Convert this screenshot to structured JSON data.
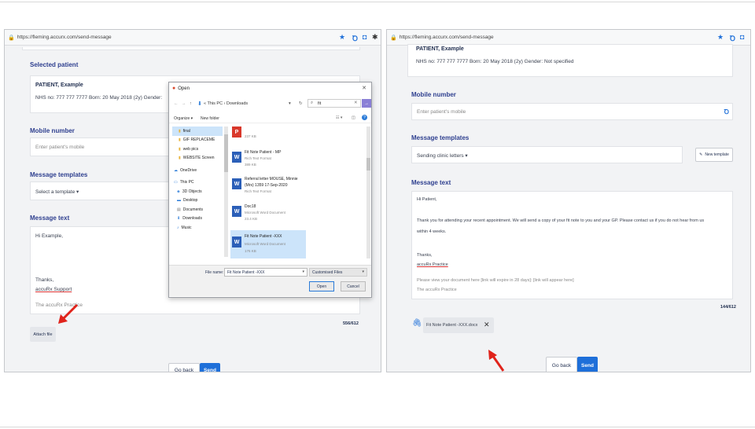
{
  "left": {
    "url": "https://fleming.accurx.com/send-message",
    "selected_patient_heading": "Selected patient",
    "patient_name": "PATIENT, Example",
    "patient_details": "NHS no: 777 777 7777    Born: 20 May 2018 (2y)    Gender:",
    "mobile_heading": "Mobile number",
    "mobile_placeholder": "Enter patient's mobile",
    "templates_heading": "Message templates",
    "template_select": "Select a template ▾",
    "message_heading": "Message text",
    "message_lines": [
      "Hi Example,",
      "Thanks,",
      "accuRx Support",
      "The accuRx Practice"
    ],
    "char_count": "556/612",
    "attach_button": "Attach file",
    "go_back": "Go back",
    "send": "Send"
  },
  "dialog": {
    "title": "Open",
    "path": "« This PC › Downloads",
    "search": "fit",
    "organize": "Organize ▾",
    "new_folder": "New folder",
    "tree": [
      "final",
      "GIF REPLACEME",
      "web pics",
      "WEBSITE Screen",
      "OneDrive",
      "This PC",
      "3D Objects",
      "Desktop",
      "Documents",
      "Downloads",
      "Music"
    ],
    "files": [
      {
        "name": "",
        "type": "",
        "size": "237 KB",
        "icon": "pdf-icon"
      },
      {
        "name": "Fit Note Patient - MP",
        "type": "Rich Text Format",
        "size": "389 KB",
        "icon": "word-icon"
      },
      {
        "name": "Referral letter MOUSE, Minnie",
        "name2": "(Mrs) 1359 17-Sep-2020",
        "type": "Rich Text Format",
        "size": "",
        "icon": "word-icon"
      },
      {
        "name": "Doc18",
        "type": "Microsoft Word Document",
        "size": "23.4 KB",
        "icon": "word-icon"
      },
      {
        "name": "Fit Note Patient -XXX",
        "type": "Microsoft Word Document",
        "size": "176 KB",
        "icon": "word-icon"
      }
    ],
    "file_name_label": "File name:",
    "file_name_value": "Fit Note Patient -XXX",
    "filter": "Customised Files",
    "open": "Open",
    "cancel": "Cancel"
  },
  "right": {
    "url": "https://fleming.accurx.com/send-message",
    "patient_name": "PATIENT, Example",
    "patient_details": "NHS no: 777 777 7777    Born: 20 May 2018 (2y)    Gender: Not specified",
    "mobile_heading": "Mobile number",
    "mobile_placeholder": "Enter patient's mobile",
    "templates_heading": "Message templates",
    "template_select": "Sending clinic letters ▾",
    "new_template": "New template",
    "message_heading": "Message text",
    "greeting": "Hi Patient,",
    "body1": "Thank you for attending your recent appointment. We will send a copy of your fit note to you and your GP. Please contact us if you do not hear from us",
    "body2": "within 4 weeks.",
    "thanks": "Thanks,",
    "signature": "accuRx Practice",
    "link_line": "Please view your document here [link will expire in 28 days]: [link will appear here]",
    "practice": "The accuRx Practice",
    "char_count": "144/612",
    "attachment": "Fit Note Patient -XXX.docx",
    "go_back": "Go back",
    "send": "Send"
  },
  "colors": {
    "primary": "#1e6fd9",
    "heading": "#2e3f8f",
    "arrow": "#e0231b"
  }
}
